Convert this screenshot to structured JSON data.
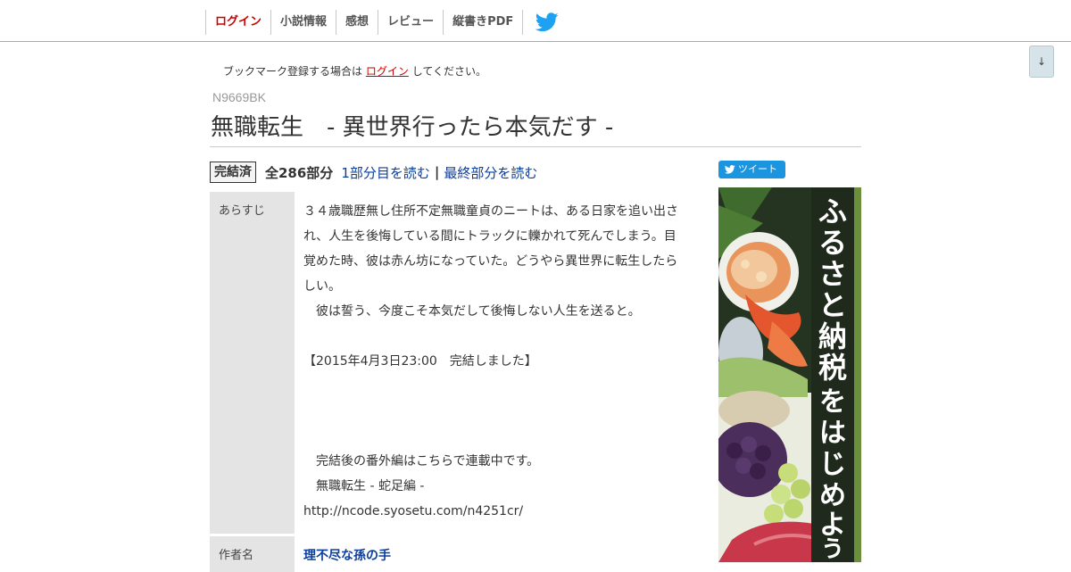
{
  "nav": {
    "items": [
      "ログイン",
      "小説情報",
      "感想",
      "レビュー",
      "縦書きPDF"
    ],
    "twitter_icon": "twitter-bird-icon"
  },
  "scroll_button": "↓",
  "bookmark_note": {
    "prefix": "ブックマーク登録する場合は",
    "link": "ログイン",
    "suffix": "してください。"
  },
  "novel": {
    "ncode": "N9669BK",
    "title": "無職転生　- 異世界行ったら本気だす -",
    "status": "完結済",
    "count": "全286部分",
    "first_link": "1部分目を読む",
    "separator": "|",
    "last_link": "最終部分を読む"
  },
  "tweet_button": "ツイート",
  "table": {
    "synopsis_label": "あらすじ",
    "synopsis_lines": [
      "３４歳職歴無し住所不定無職童貞のニートは、ある日家を追い出さ",
      "れ、人生を後悔している間にトラックに轢かれて死んでしまう。目",
      "覚めた時、彼は赤ん坊になっていた。どうやら異世界に転生したら",
      "しい。",
      "　彼は誓う、今度こそ本気だして後悔しない人生を送ると。",
      "",
      "【2015年4月3日23:00　完結しました】",
      "",
      "",
      "",
      "　完結後の番外編はこちらで連載中です。",
      "　無職転生 - 蛇足編 -",
      "http://ncode.syosetu.com/n4251cr/"
    ],
    "author_label": "作者名",
    "author": "理不尽な孫の手"
  },
  "ad": {
    "vertical_text": "ふるさと納税をはじめよう",
    "colors": {
      "banner_bg": "#1f2a1c",
      "accent": "#cfe3a0",
      "text": "#ffffff"
    }
  },
  "colors": {
    "link": "#0b3e9c",
    "login": "#cc0000",
    "label_bg": "#e4e4e4",
    "tweet": "#1b95e0"
  }
}
